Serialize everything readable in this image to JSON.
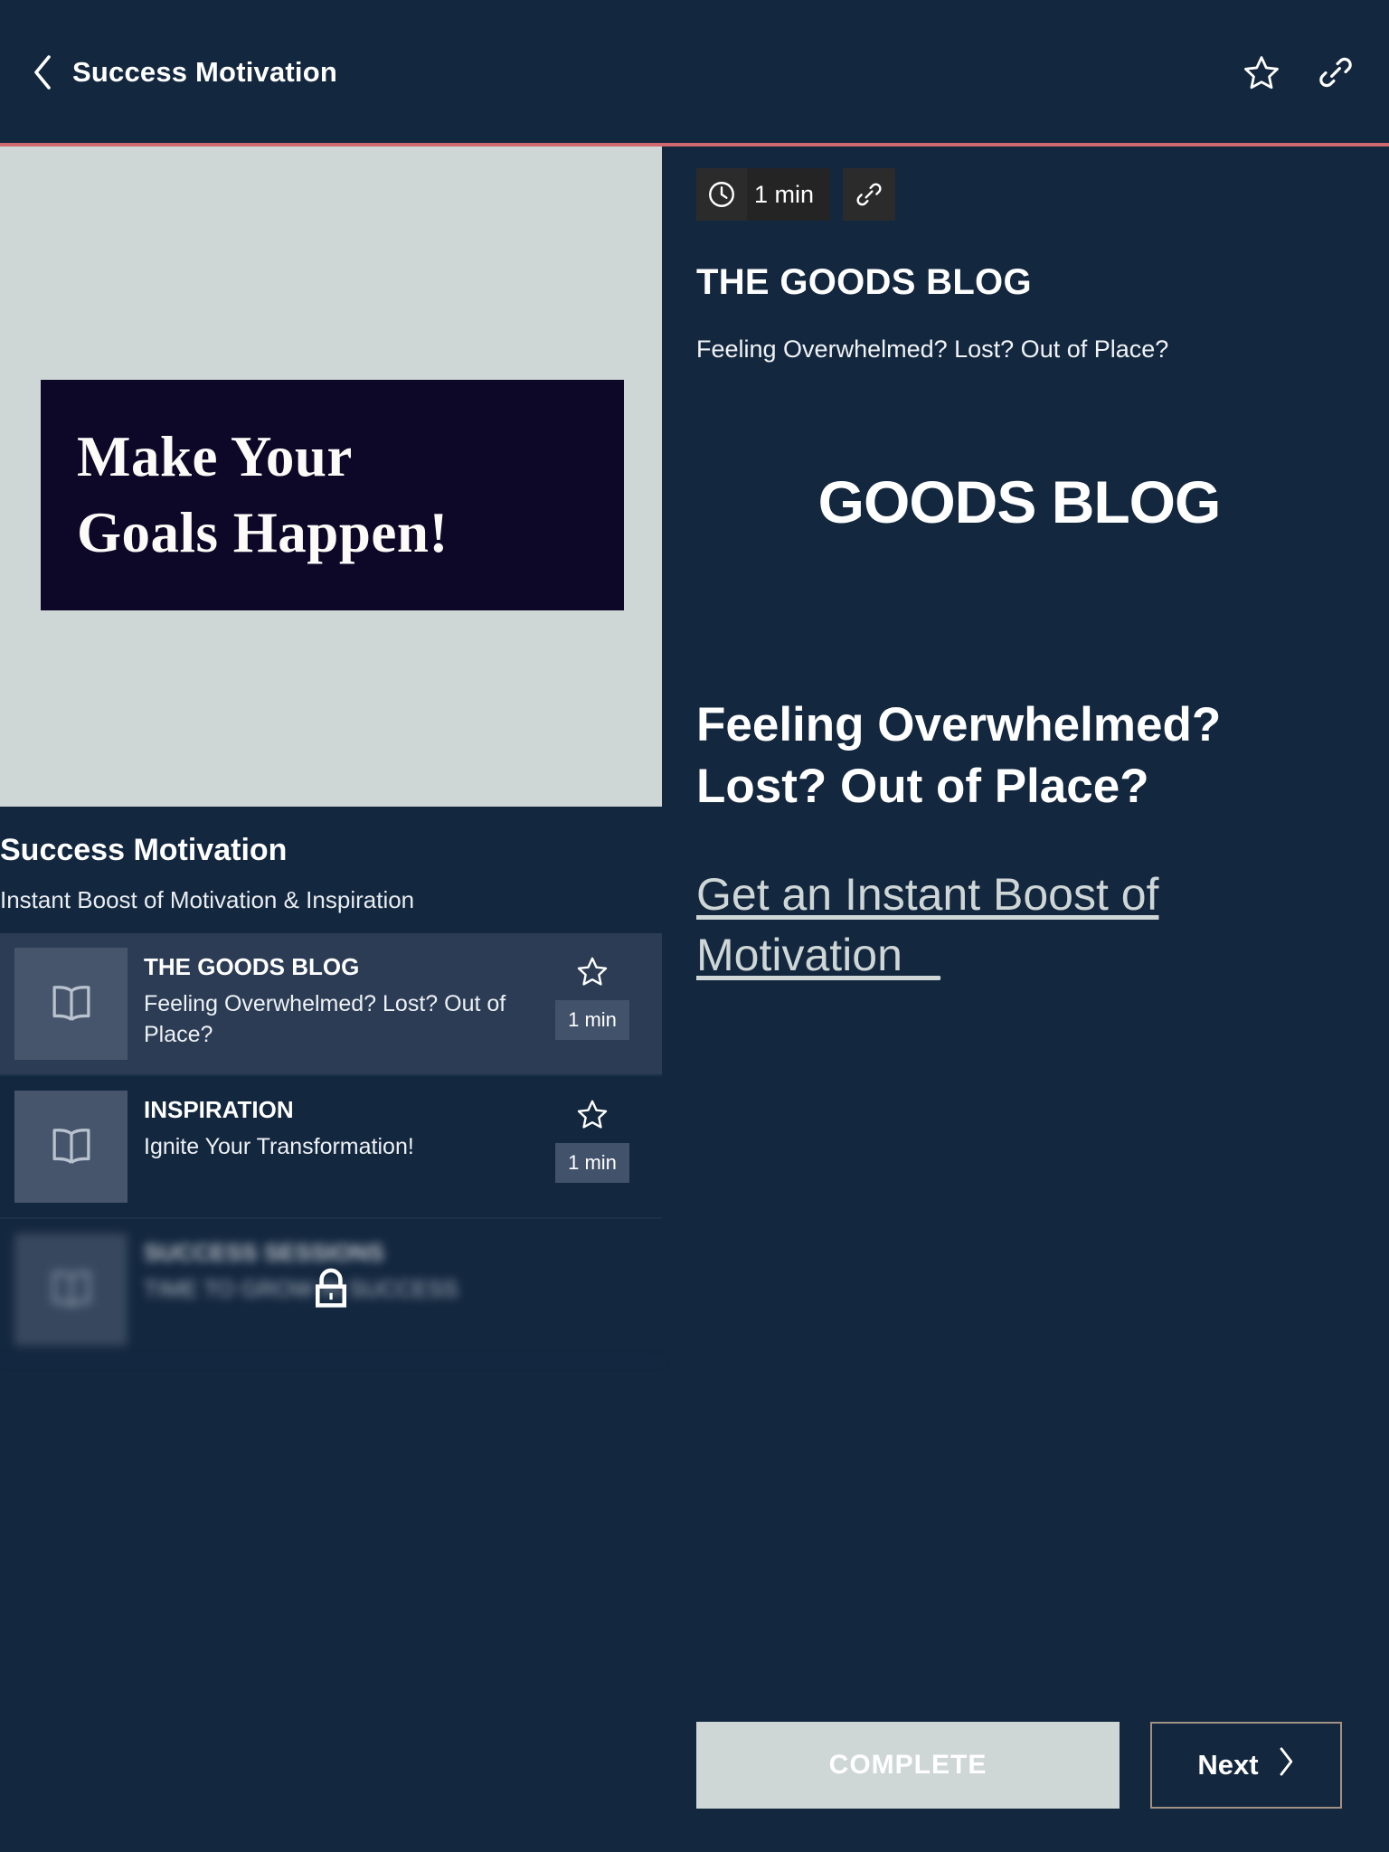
{
  "topbar": {
    "back_icon": "chevron-left-icon",
    "title": "Success Motivation",
    "favorite_icon": "star-icon",
    "share_icon": "link-icon"
  },
  "theme": {
    "page_bg": "#13273f",
    "accent_rule": "#d16a6f",
    "sage": "#ced6d6",
    "active_row": "#2b3c54",
    "thumb_bg": "#46556b",
    "chip_bg": "#2b2b2b",
    "next_border": "#a39183"
  },
  "hero": {
    "background": "#ced6d6",
    "band_background": "#0d0828",
    "line1": "Make Your",
    "line2": "Goals Happen!"
  },
  "course": {
    "title": "Success Motivation",
    "subtitle": "Instant Boost of Motivation & Inspiration"
  },
  "lessons": [
    {
      "kicker": "THE GOODS BLOG",
      "description": "Feeling Overwhelmed? Lost? Out of Place?",
      "duration": "1 min",
      "thumb_icon": "open-book-icon",
      "star_icon": "star-icon",
      "state": "active"
    },
    {
      "kicker": "INSPIRATION",
      "description": "Ignite Your Transformation!",
      "duration": "1 min",
      "thumb_icon": "open-book-icon",
      "star_icon": "star-icon",
      "state": "default"
    },
    {
      "kicker": "SUCCESS SESSIONS",
      "description": "TIME TO GROW IN SUCCESS",
      "duration": "",
      "thumb_icon": "open-book-icon",
      "star_icon": "star-icon",
      "state": "locked",
      "lock_icon": "lock-icon"
    }
  ],
  "article": {
    "clock_icon": "clock-icon",
    "duration": "1 min",
    "share_icon": "link-icon",
    "kicker": "THE GOODS BLOG",
    "subtitle": "Feeling Overwhelmed? Lost? Out of Place?",
    "brand_logo": "GOODS BLOG",
    "heading": "Feeling Overwhelmed? Lost? Out of Place?",
    "link_text": "Get an Instant Boost of Motivation _"
  },
  "footer": {
    "complete_label": "COMPLETE",
    "next_label": "Next",
    "next_icon": "chevron-right-icon"
  }
}
